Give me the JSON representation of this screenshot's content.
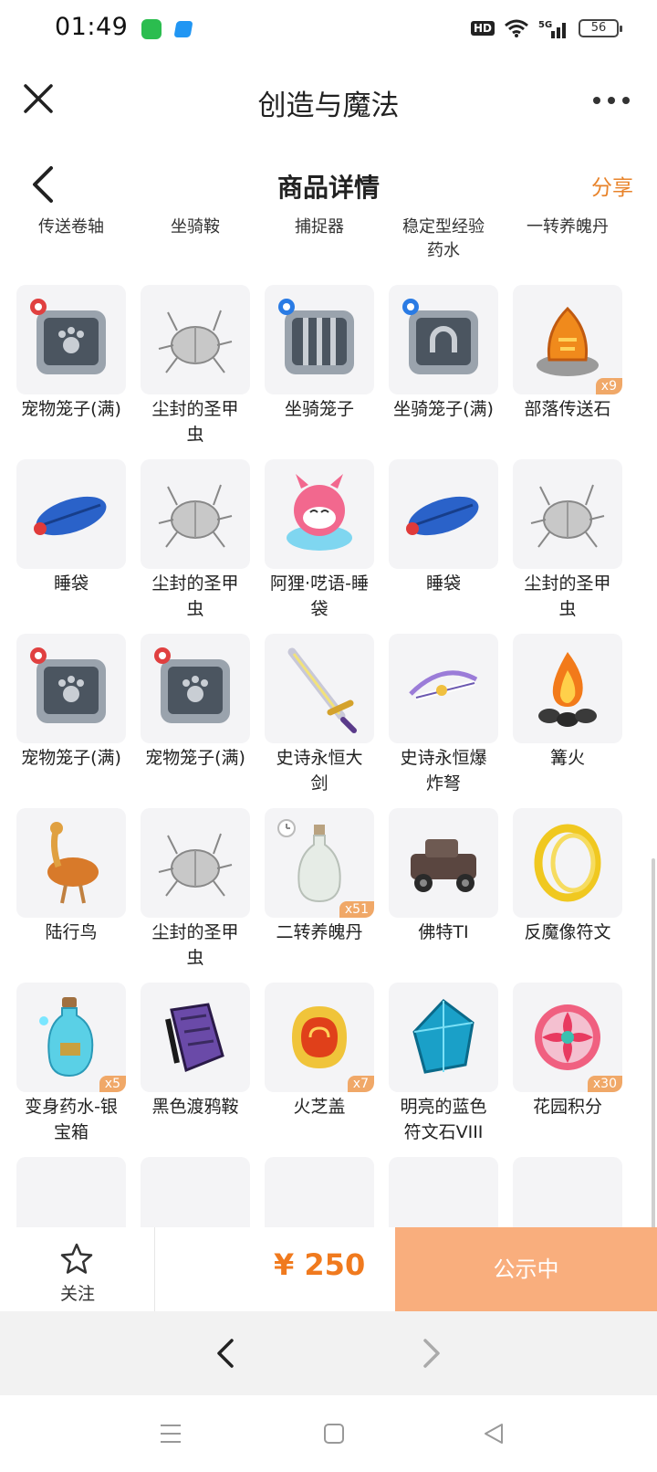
{
  "status_bar": {
    "time": "01:49",
    "hd": "HD",
    "network": "5G",
    "battery": "56"
  },
  "nav": {
    "title": "创造与魔法"
  },
  "subheader": {
    "title": "商品详情",
    "share": "分享"
  },
  "top_row": [
    "传送卷轴",
    "坐骑鞍",
    "捕捉器",
    "稳定型经验\n药水",
    "一转养魄丹"
  ],
  "items": [
    {
      "name": "宠物笼子(满)",
      "icon": "pet-cage-icon",
      "qty": ""
    },
    {
      "name": "尘封的圣甲\n虫",
      "icon": "beetle-icon",
      "qty": ""
    },
    {
      "name": "坐骑笼子",
      "icon": "mount-cage-icon",
      "qty": ""
    },
    {
      "name": "坐骑笼子(满)",
      "icon": "mount-cage-full-icon",
      "qty": ""
    },
    {
      "name": "部落传送石",
      "icon": "teleport-stone-icon",
      "qty": "x9"
    },
    {
      "name": "睡袋",
      "icon": "sleeping-bag-icon",
      "qty": ""
    },
    {
      "name": "尘封的圣甲\n虫",
      "icon": "beetle-icon",
      "qty": ""
    },
    {
      "name": "阿狸·呓语-睡\n袋",
      "icon": "ali-sleeping-bag-icon",
      "qty": ""
    },
    {
      "name": "睡袋",
      "icon": "sleeping-bag-icon",
      "qty": ""
    },
    {
      "name": "尘封的圣甲\n虫",
      "icon": "beetle-icon",
      "qty": ""
    },
    {
      "name": "宠物笼子(满)",
      "icon": "pet-cage-icon",
      "qty": ""
    },
    {
      "name": "宠物笼子(满)",
      "icon": "pet-cage-icon",
      "qty": ""
    },
    {
      "name": "史诗永恒大\n剑",
      "icon": "greatsword-icon",
      "qty": ""
    },
    {
      "name": "史诗永恒爆\n炸弩",
      "icon": "crossbow-icon",
      "qty": ""
    },
    {
      "name": "篝火",
      "icon": "bonfire-icon",
      "qty": ""
    },
    {
      "name": "陆行鸟",
      "icon": "ostrich-icon",
      "qty": ""
    },
    {
      "name": "尘封的圣甲\n虫",
      "icon": "beetle-icon",
      "qty": ""
    },
    {
      "name": "二转养魄丹",
      "icon": "potion-bottle-icon",
      "qty": "x51"
    },
    {
      "name": "佛特TI",
      "icon": "car-icon",
      "qty": ""
    },
    {
      "name": "反魔像符文",
      "icon": "rune-ring-icon",
      "qty": ""
    },
    {
      "name": "变身药水-银\n宝箱",
      "icon": "transform-potion-icon",
      "qty": "x5"
    },
    {
      "name": "黑色渡鸦鞍",
      "icon": "raven-saddle-icon",
      "qty": ""
    },
    {
      "name": "火芝盖",
      "icon": "fire-mushroom-icon",
      "qty": "x7"
    },
    {
      "name": "明亮的蓝色\n符文石VIII",
      "icon": "blue-rune-stone-icon",
      "qty": ""
    },
    {
      "name": "花园积分",
      "icon": "garden-points-icon",
      "qty": "x30"
    },
    {
      "name": "",
      "icon": "partial-item-icon",
      "qty": ""
    },
    {
      "name": "",
      "icon": "partial-item-icon",
      "qty": ""
    },
    {
      "name": "",
      "icon": "partial-item-icon",
      "qty": ""
    },
    {
      "name": "",
      "icon": "partial-item-icon",
      "qty": ""
    },
    {
      "name": "",
      "icon": "partial-item-icon",
      "qty": ""
    }
  ],
  "action_bar": {
    "follow": "关注",
    "price": "¥ 250",
    "status": "公示中"
  },
  "colors": {
    "accent": "#f07a1e",
    "status_button": "#f9ae7d",
    "share": "#e8832a"
  }
}
